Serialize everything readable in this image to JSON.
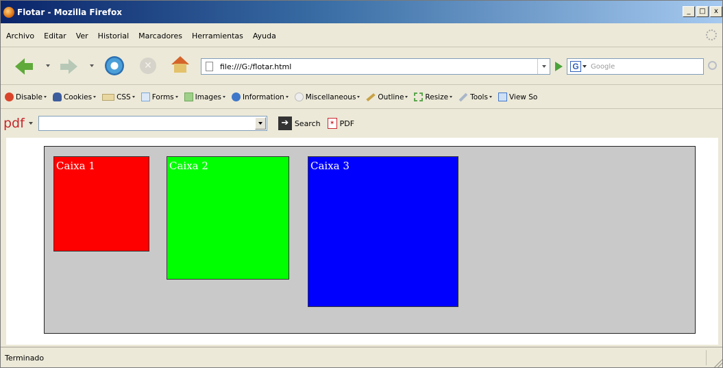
{
  "window": {
    "title": "Flotar - Mozilla Firefox",
    "controls": {
      "minimize": "_",
      "maximize": "□",
      "close": "x"
    }
  },
  "menu": {
    "items": [
      "Archivo",
      "Editar",
      "Ver",
      "Historial",
      "Marcadores",
      "Herramientas",
      "Ayuda"
    ]
  },
  "nav": {
    "url": "file:///G:/flotar.html",
    "search_placeholder": "Google",
    "search_engine_icon": "G"
  },
  "dev_toolbar": {
    "items": [
      {
        "label": "Disable",
        "icon": "disable-icon",
        "color": "#d9452b"
      },
      {
        "label": "Cookies",
        "icon": "cookies-icon",
        "color": "#3c5c9c"
      },
      {
        "label": "CSS",
        "icon": "css-icon",
        "color": "#e8d7a0"
      },
      {
        "label": "Forms",
        "icon": "forms-icon",
        "color": "#7aa6d8"
      },
      {
        "label": "Images",
        "icon": "images-icon",
        "color": "#6da85a"
      },
      {
        "label": "Information",
        "icon": "information-icon",
        "color": "#3f77c9"
      },
      {
        "label": "Miscellaneous",
        "icon": "miscellaneous-icon",
        "color": "#d8d8d8"
      },
      {
        "label": "Outline",
        "icon": "outline-icon",
        "color": "#c9a245"
      },
      {
        "label": "Resize",
        "icon": "resize-icon",
        "color": "#5aa44c"
      },
      {
        "label": "Tools",
        "icon": "tools-icon",
        "color": "#a9b6c9"
      },
      {
        "label": "View So",
        "icon": "view-source-icon",
        "color": "#3f77c9"
      }
    ]
  },
  "pdf_toolbar": {
    "logo": "pdf",
    "input_value": "",
    "search_label": "Search",
    "pdf_label": "PDF"
  },
  "content": {
    "container_color": "#c9c9c9",
    "boxes": [
      {
        "label": "Caixa 1",
        "color": "#ff0000"
      },
      {
        "label": "Caixa 2",
        "color": "#00ff00"
      },
      {
        "label": "Caixa 3",
        "color": "#0000ff"
      }
    ]
  },
  "status": {
    "text": "Terminado"
  }
}
